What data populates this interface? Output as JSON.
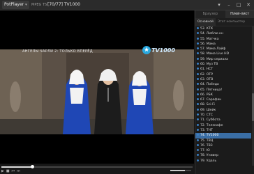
{
  "app": {
    "name": "PotPlayer",
    "format": "MPEG TS",
    "title": "[70/77] TV1000"
  },
  "video": {
    "overlay_text": "АНГЕЛЫ ЧАРЛИ 2: ТОЛЬКО ВПЕРЁД",
    "logo": "TV1000"
  },
  "playlist": {
    "tabs": [
      "Браузер",
      "Плей-лист"
    ],
    "subtabs": [
      "Основной",
      "Этот компьютер"
    ],
    "items": [
      "53. КТК",
      "54. Люблю кн",
      "55. Матчка",
      "56. Мама",
      "57. Мама Лайф",
      "58. Мама Live HD",
      "59. Мир сериала",
      "60. Муз ТВ",
      "61. НСТ",
      "62. ОТР",
      "63. ОТВ",
      "64. Победа",
      "65. Пятница!",
      "66. РБК",
      "67. Сарафан",
      "68. Sci-Fi",
      "69. Шейк",
      "70. СТС",
      "71. Суббота",
      "72. Телекафе",
      "73. ТНТ",
      "74. TV1000",
      "75. ТВЦ",
      "76. ТВ3",
      "77. Ю",
      "78. Унивeр",
      "79. Удаль"
    ],
    "selected_index": 21,
    "list_scroll_fraction": 0.6
  },
  "playback": {
    "position_fraction": 0.16,
    "volume_fraction": 0.7
  }
}
